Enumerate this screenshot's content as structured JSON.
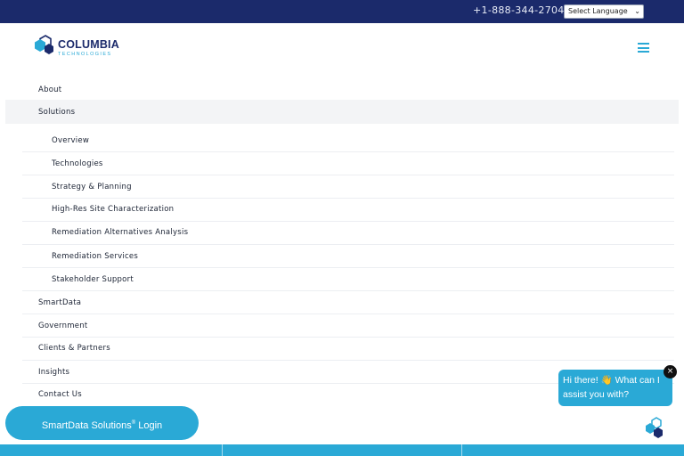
{
  "topbar": {
    "phone": "+1-888-344-2704",
    "language_select": "Select Language"
  },
  "header": {
    "logo_word": "COLUMBIA",
    "logo_sub": "TECHNOLOGIES"
  },
  "menu": {
    "about": "About",
    "solutions": "Solutions",
    "submenu": [
      "Overview",
      "Technologies",
      "Strategy & Planning",
      "High-Res Site Characterization",
      "Remediation Alternatives Analysis",
      "Remediation Services",
      "Stakeholder Support"
    ],
    "smartdata": "SmartData",
    "government": "Government",
    "clients": "Clients & Partners",
    "insights": "Insights",
    "contact": "Contact Us"
  },
  "login_button": {
    "label": "SmartData Solutions",
    "reg": "®",
    "suffix": " Login"
  },
  "chat": {
    "message": "Hi there! 👋 What can I assist you with?",
    "close": "×"
  },
  "colors": {
    "navy": "#1b2a6b",
    "accent": "#2aa9d6"
  },
  "icons": {
    "menu": "hamburger-menu-icon",
    "close": "close-icon",
    "chat": "chat-launcher-icon",
    "logo": "hexagon-logo-icon"
  }
}
